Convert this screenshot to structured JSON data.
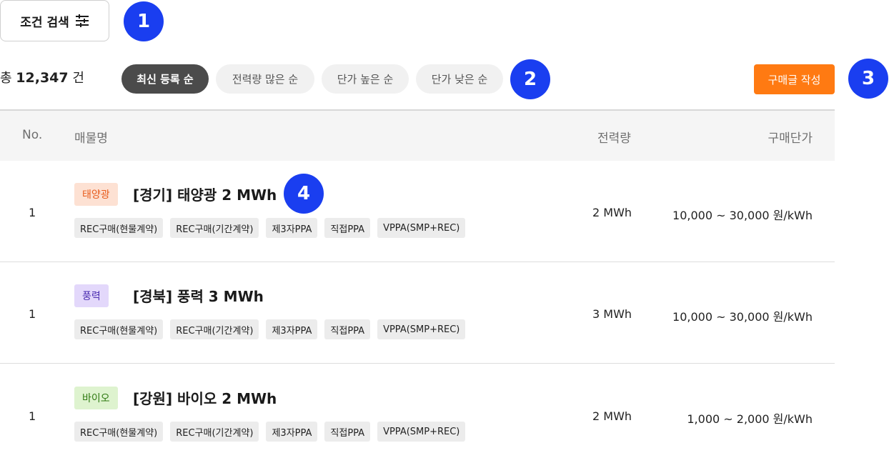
{
  "search_button": {
    "label": "조건 검색",
    "icon": "filter-icon"
  },
  "badges": [
    "1",
    "2",
    "3",
    "4"
  ],
  "summary": {
    "prefix": "총",
    "count": "12,347",
    "suffix": "건"
  },
  "sort_options": [
    {
      "label": "최신 등록 순",
      "active": true
    },
    {
      "label": "전력량 많은 순",
      "active": false
    },
    {
      "label": "단가 높은 순",
      "active": false
    },
    {
      "label": "단가 낮은 순",
      "active": false
    }
  ],
  "write_button": {
    "label": "구매글 작성"
  },
  "table": {
    "headers": {
      "no": "No.",
      "name": "매물명",
      "power": "전력량",
      "price": "구매단가"
    },
    "rows": [
      {
        "no": "1",
        "category": "태양광",
        "category_bg": "#fde1d3",
        "category_color": "#e85a1a",
        "title": "[경기] 태양광 2 MWh",
        "tags": [
          "REC구매(현물계약)",
          "REC구매(기간계약)",
          "제3자PPA",
          "직접PPA",
          "VPPA(SMP+REC)"
        ],
        "power": "2 MWh",
        "price": "10,000 ~ 30,000 원/kWh"
      },
      {
        "no": "1",
        "category": "풍력",
        "category_bg": "#e3d8fb",
        "category_color": "#4a2bb0",
        "title": "[경북] 풍력 3 MWh",
        "tags": [
          "REC구매(현물계약)",
          "REC구매(기간계약)",
          "제3자PPA",
          "직접PPA",
          "VPPA(SMP+REC)"
        ],
        "power": "3 MWh",
        "price": "10,000 ~ 30,000 원/kWh"
      },
      {
        "no": "1",
        "category": "바이오",
        "category_bg": "#def3cf",
        "category_color": "#2f7a12",
        "title": "[강원] 바이오 2 MWh",
        "tags": [
          "REC구매(현물계약)",
          "REC구매(기간계약)",
          "제3자PPA",
          "직접PPA",
          "VPPA(SMP+REC)"
        ],
        "power": "2 MWh",
        "price": "1,000 ~ 2,000 원/kWh"
      }
    ]
  },
  "colors": {
    "accent": "#ff7a12",
    "badge": "#1a3ef0",
    "active_chip": "#4b4b4b"
  }
}
